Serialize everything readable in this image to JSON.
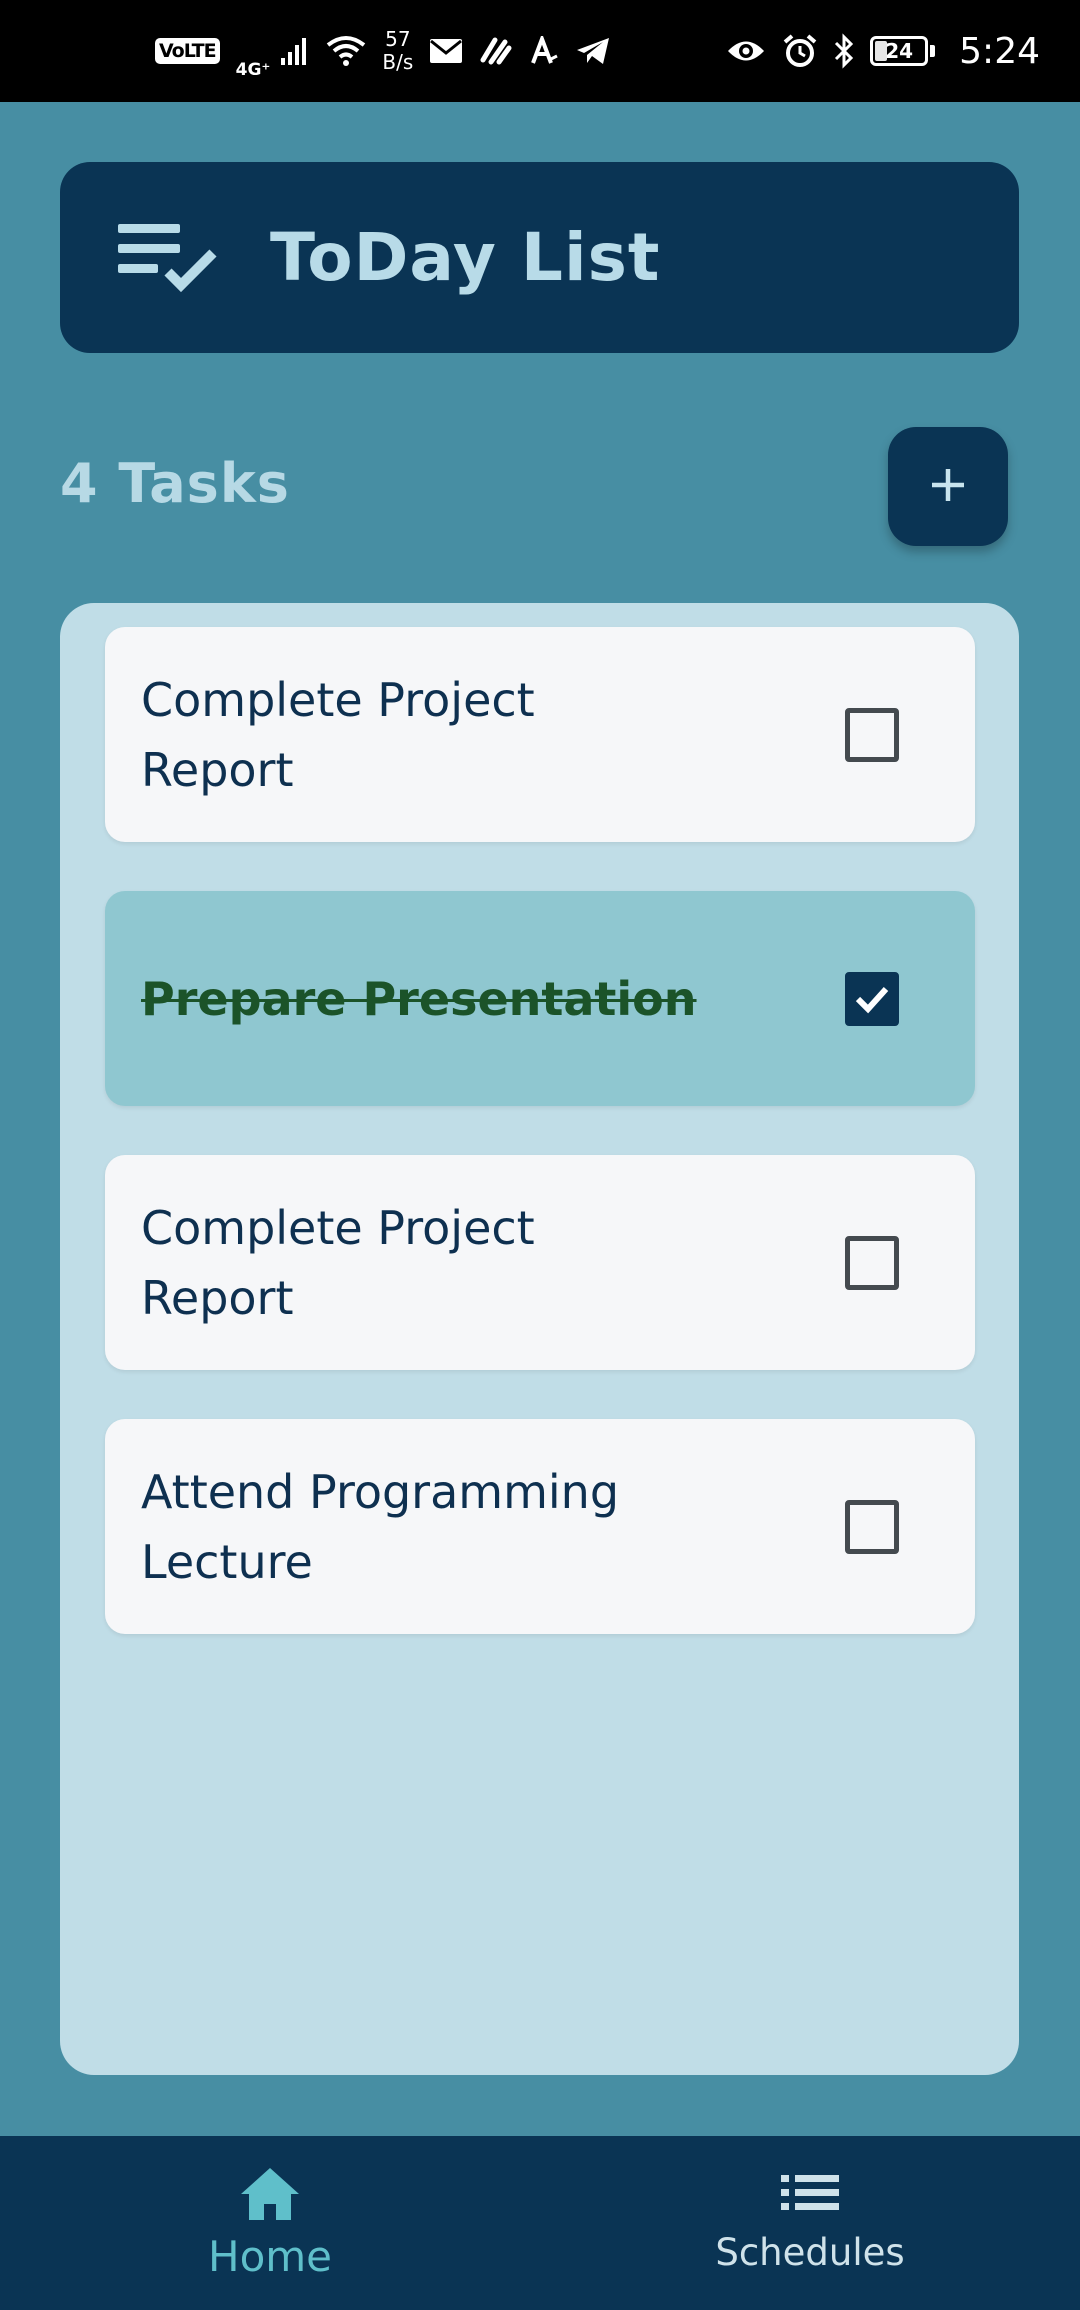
{
  "status_bar": {
    "volte": "VoLTE",
    "network": "4G⁺",
    "speed_value": "57",
    "speed_unit": "B/s",
    "battery": "24",
    "time": "5:24"
  },
  "header": {
    "icon": "playlist-check-icon",
    "title": "ToDay List"
  },
  "summary": {
    "task_count_label": "4 Tasks",
    "add_icon": "plus-icon"
  },
  "tasks": [
    {
      "title": "Complete Project Report",
      "done": false
    },
    {
      "title": "Prepare Presentation",
      "done": true
    },
    {
      "title": "Complete Project Report",
      "done": false
    },
    {
      "title": "Attend Programming Lecture",
      "done": false
    }
  ],
  "bottom_nav": {
    "items": [
      {
        "label": "Home",
        "icon": "home-icon",
        "active": true
      },
      {
        "label": "Schedules",
        "icon": "list-icon",
        "active": false
      }
    ]
  },
  "colors": {
    "background": "#478ea3",
    "primary": "#0a3454",
    "panel": "#c0dde7",
    "card": "#f6f7f9",
    "card_done": "#8fc7d0",
    "done_text": "#1b5329",
    "active_nav": "#5fbfca"
  }
}
